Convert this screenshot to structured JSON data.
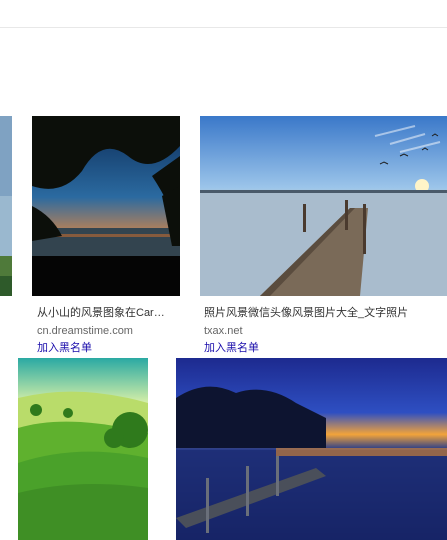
{
  "results": [
    {
      "title": "从小山的风景图象在Car…",
      "source": "cn.dreamstime.com",
      "blacklist_label": "加入黑名单"
    },
    {
      "title": "照片风景微信头像风景图片大全_文字照片",
      "source": "txax.net",
      "blacklist_label": "加入黑名单"
    }
  ]
}
